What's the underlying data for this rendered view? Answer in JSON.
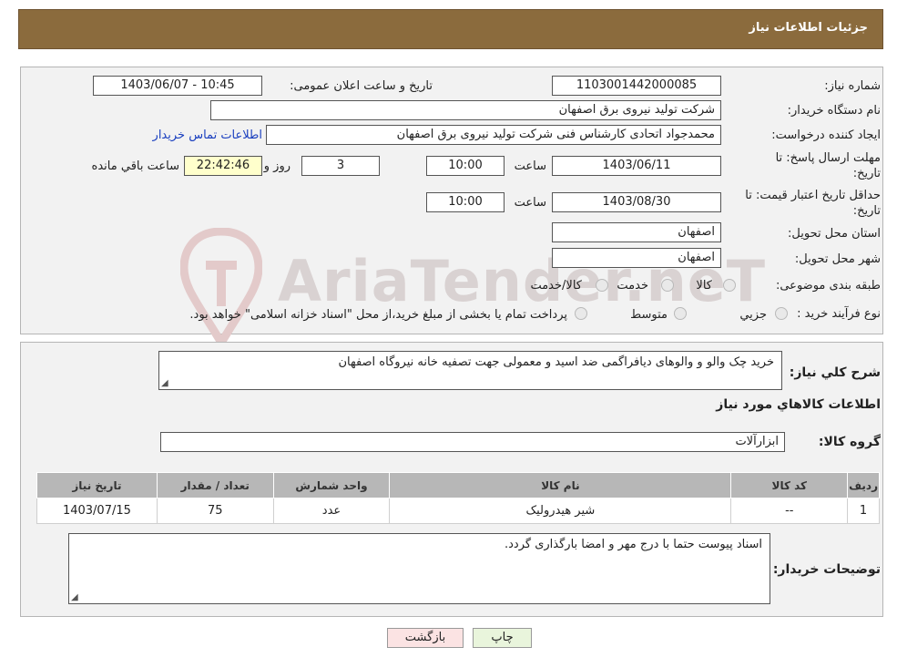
{
  "header": {
    "title": "جزئیات اطلاعات نیاز"
  },
  "watermark": {
    "text": "AriaTender.neT"
  },
  "fields": {
    "need_number_label": "شماره نیاز:",
    "need_number": "1103001442000085",
    "announce_label": "تاریخ و ساعت اعلان عمومی:",
    "announce_value": "1403/06/07 - 10:45",
    "buyer_org_label": "نام دستگاه خریدار:",
    "buyer_org": "شرکت تولید نیروی برق اصفهان",
    "creator_label": "ایجاد کننده درخواست:",
    "creator": "محمدجواد اتحادی کارشناس فنی شرکت تولید نیروی برق اصفهان",
    "contact_link": "اطلاعات تماس خریدار",
    "reply_label_1": "مهلت ارسال پاسخ: تا",
    "reply_label_2": "تاریخ:",
    "reply_date": "1403/06/11",
    "reply_time_label": "ساعت",
    "reply_time": "10:00",
    "days_value": "3",
    "days_label": "روز و",
    "remaining_time": "22:42:46",
    "remaining_label": "ساعت باقي مانده",
    "validity_label_1": "حداقل تاریخ اعتبار قیمت: تا",
    "validity_label_2": "تاریخ:",
    "validity_date": "1403/08/30",
    "validity_time_label": "ساعت",
    "validity_time": "10:00",
    "province_label": "استان محل تحویل:",
    "province": "اصفهان",
    "city_label": "شهر محل تحویل:",
    "city": "اصفهان",
    "category_label": "طبقه بندی موضوعی:",
    "category_options": [
      "کالا",
      "خدمت",
      "کالا/خدمت"
    ],
    "process_label": "نوع فرآیند خرید :",
    "process_options": [
      "جزیي",
      "متوسط"
    ],
    "payment_note": "پرداخت تمام یا بخشی از مبلغ خرید،از محل \"اسناد خزانه اسلامی\" خواهد بود."
  },
  "description": {
    "label": "شرح کلي نیاز:",
    "value": "خرید چک والو و والوهای دیافراگمی ضد اسید و معمولی جهت تصفیه خانه نیروگاه اصفهان"
  },
  "items_section": {
    "title": "اطلاعات کالاهاي مورد نیاز",
    "group_label": "گروه کالا:",
    "group_value": "ابزارآلات",
    "columns": [
      "ردیف",
      "کد کالا",
      "نام کالا",
      "واحد شمارش",
      "تعداد / مقدار",
      "تاریخ نیاز"
    ],
    "rows": [
      {
        "row": "1",
        "code": "--",
        "name": "شیر هیدرولیک",
        "unit": "عدد",
        "qty": "75",
        "date": "1403/07/15"
      }
    ]
  },
  "buyer_notes": {
    "label": "توضیحات خریدار:",
    "value": "اسناد پیوست حتما با درج مهر و امضا بارگذاری گردد."
  },
  "buttons": {
    "print": "چاپ",
    "back": "بازگشت"
  },
  "colors": {
    "header_bg": "#8b6b3d",
    "print_bg": "#e9f5dc",
    "back_bg": "#fbe3e3",
    "link": "#1a3fbf"
  }
}
